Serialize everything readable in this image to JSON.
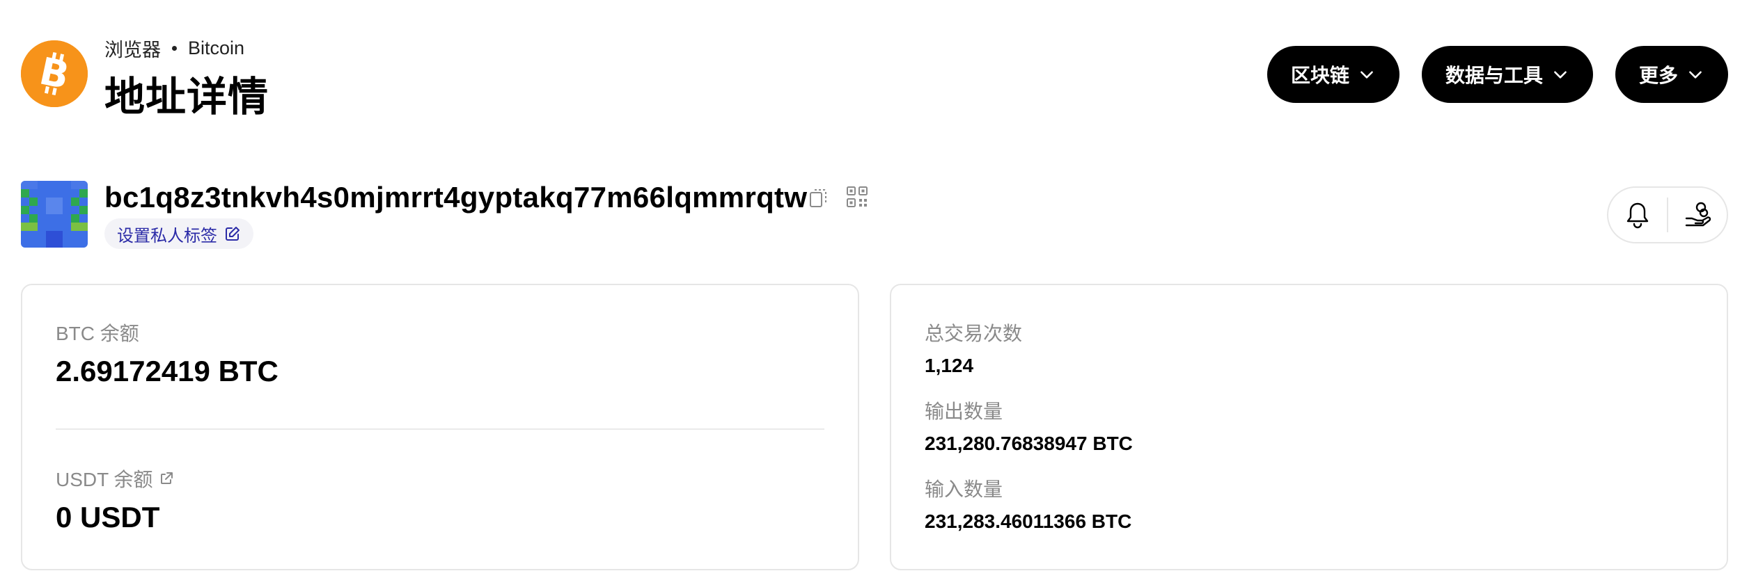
{
  "header": {
    "breadcrumb_section": "浏览器",
    "breadcrumb_chain": "Bitcoin",
    "title": "地址详情",
    "coin_icon": "bitcoin-icon",
    "brand_color": "#F7931A"
  },
  "nav": {
    "items": [
      {
        "label": "区块链",
        "icon": "chevron-down-icon"
      },
      {
        "label": "数据与工具",
        "icon": "chevron-down-icon"
      },
      {
        "label": "更多",
        "icon": "chevron-down-icon"
      }
    ]
  },
  "address": {
    "value": "bc1q8z3tnkvh4s0mjmrrt4gyptakq77m66lqmmrqtw",
    "set_tag_label": "设置私人标签",
    "copy_icon": "copy-icon",
    "qr_icon": "qr-code-icon",
    "tag_color": "#2B2BA7"
  },
  "actions": {
    "alert_icon": "bell-icon",
    "donate_icon": "hand-coin-icon"
  },
  "balances": {
    "btc_label": "BTC 余额",
    "btc_value": "2.69172419 BTC",
    "usdt_label": "USDT 余额",
    "usdt_value": "0 USDT"
  },
  "stats": {
    "tx_count_label": "总交易次数",
    "tx_count_value": "1,124",
    "out_label": "输出数量",
    "out_value": "231,280.76838947 BTC",
    "in_label": "输入数量",
    "in_value": "231,283.46011366 BTC"
  }
}
